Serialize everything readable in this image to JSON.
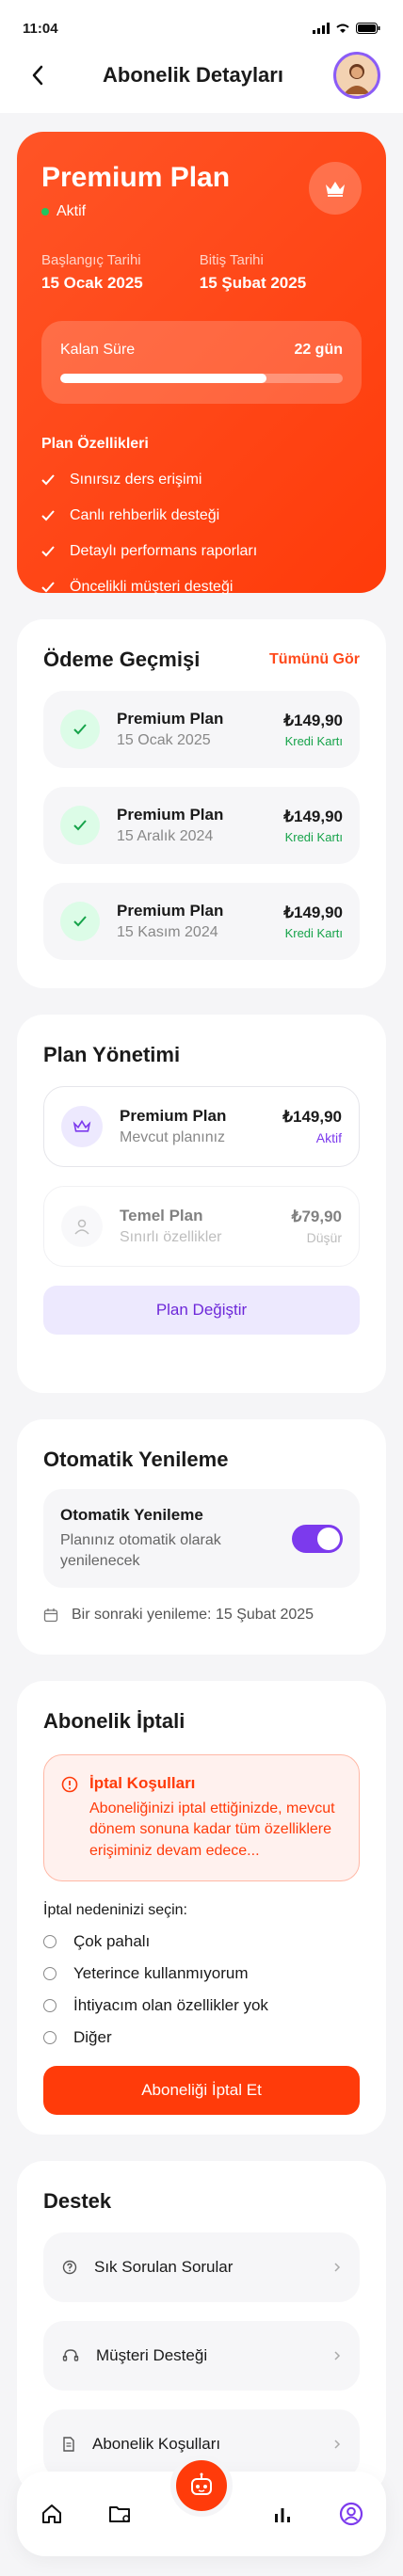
{
  "status_bar": {
    "time": "11:04"
  },
  "header": {
    "title": "Abonelik Detayları"
  },
  "premium": {
    "title": "Premium Plan",
    "status": "Aktif",
    "start_label": "Başlangıç Tarihi",
    "start_value": "15 Ocak 2025",
    "end_label": "Bitiş Tarihi",
    "end_value": "15 Şubat 2025",
    "remaining_label": "Kalan Süre",
    "remaining_value": "22 gün",
    "remaining_progress_percent": 73,
    "features_title": "Plan Özellikleri",
    "features": [
      "Sınırsız ders erişimi",
      "Canlı rehberlik desteği",
      "Detaylı performans raporları",
      "Öncelikli müşteri desteği"
    ]
  },
  "payments": {
    "title": "Ödeme Geçmişi",
    "see_all": "Tümünü Gör",
    "items": [
      {
        "name": "Premium Plan",
        "date": "15 Ocak 2025",
        "amount": "₺149,90",
        "method": "Kredi Kartı"
      },
      {
        "name": "Premium Plan",
        "date": "15 Aralık 2024",
        "amount": "₺149,90",
        "method": "Kredi Kartı"
      },
      {
        "name": "Premium Plan",
        "date": "15 Kasım 2024",
        "amount": "₺149,90",
        "method": "Kredi Kartı"
      }
    ]
  },
  "plans": {
    "title": "Plan Yönetimi",
    "items": [
      {
        "name": "Premium Plan",
        "desc": "Mevcut planınız",
        "price": "₺149,90",
        "badge": "Aktif"
      },
      {
        "name": "Temel Plan",
        "desc": "Sınırlı özellikler",
        "price": "₺79,90",
        "badge": "Düşür"
      }
    ],
    "change_button": "Plan Değiştir"
  },
  "renewal": {
    "title": "Otomatik Yenileme",
    "box_title": "Otomatik Yenileme",
    "box_sub": "Planınız otomatik olarak yenilenecek",
    "next": "Bir sonraki yenileme: 15 Şubat 2025"
  },
  "cancel": {
    "title": "Abonelik İptali",
    "warn_title": "İptal Koşulları",
    "warn_text": "Aboneliğinizi iptal ettiğinizde, mevcut dönem sonuna kadar tüm özelliklere erişiminiz devam edece...",
    "reason_label": "İptal nedeninizi seçin:",
    "reasons": [
      "Çok pahalı",
      "Yeterince kullanmıyorum",
      "İhtiyacım olan özellikler yok",
      "Diğer"
    ],
    "button": "Aboneliği İptal Et"
  },
  "support": {
    "title": "Destek",
    "items": [
      "Sık Sorulan Sorular",
      "Müşteri Desteği",
      "Abonelik Koşulları"
    ]
  },
  "colors": {
    "accent": "#ff3b0a",
    "purple": "#7c3aed",
    "green": "#16a34a"
  }
}
